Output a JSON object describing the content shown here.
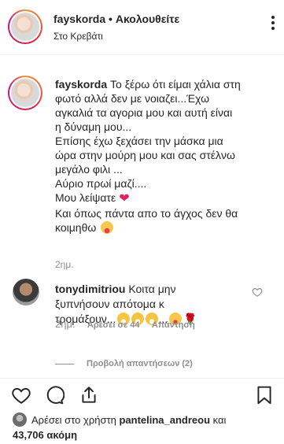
{
  "header": {
    "username": "fayskorda",
    "separator": "•",
    "follow_label": "Ακολουθείτε",
    "location": "Στο Κρεβάτι"
  },
  "caption": {
    "username": "fayskorda",
    "lines": [
      "Το ξέρω ότι είμαι χάλια στη",
      "φωτό αλλά δεν με νοιαζει...Έχω",
      "αγκαλιά τα αγορια μου και αυτή είναι",
      "η δύναμη μου...",
      "Επίσης έχω ξεχάσει την μάσκα μια",
      "ώρα στην μούρη μου και σας στέλνω",
      "μεγάλο φιλι ...",
      "Αύριο πρωί μαζί....",
      "Μου λείψατε",
      "Και όπως πάντα απο το άγχος δεν θα",
      "κοιμηθω"
    ],
    "time": "2ημ."
  },
  "comment": {
    "username": "tonydimitriou",
    "text_line1": "Κοιτα μην",
    "text_line2": "ξυπνήσουν απότομα κ",
    "text_line3": "τρομάξουν...",
    "time": "2ημ.",
    "likes": "Αρέσει σε 44",
    "reply": "Απάντηση",
    "view_replies": "Προβολή απαντήσεων (2)"
  },
  "actions": {
    "icons": [
      "heart-icon",
      "comment-icon",
      "share-icon",
      "bookmark-icon"
    ]
  },
  "likes_summary": {
    "prefix": "Αρέσει στο χρήστη",
    "user": "pantelina_andreou",
    "conj": "και",
    "count": "43,706 ακόμη"
  }
}
